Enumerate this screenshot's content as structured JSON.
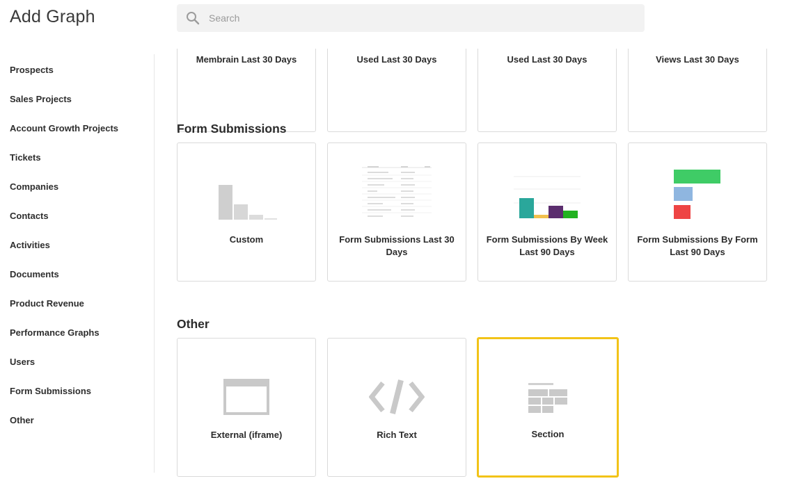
{
  "page": {
    "title": "Add Graph"
  },
  "search": {
    "placeholder": "Search"
  },
  "sidebar": {
    "items": [
      "Prospects",
      "Sales Projects",
      "Account Growth Projects",
      "Tickets",
      "Companies",
      "Contacts",
      "Activities",
      "Documents",
      "Product Revenue",
      "Performance Graphs",
      "Users",
      "Form Submissions",
      "Other"
    ]
  },
  "top_row": {
    "cards": [
      {
        "label": "Membrain Last 30 Days"
      },
      {
        "label": "Used Last 30 Days"
      },
      {
        "label": "Used Last 30 Days"
      },
      {
        "label": "Views Last 30 Days"
      }
    ]
  },
  "form_submissions": {
    "title": "Form Submissions",
    "cards": [
      {
        "label": "Custom",
        "icon": "bar-chart-icon"
      },
      {
        "label": "Form Submissions Last 30 Days",
        "icon": "table-preview-icon"
      },
      {
        "label": "Form Submissions By Week Last 90 Days",
        "icon": "column-chart-icon"
      },
      {
        "label": "Form Submissions By Form Last 90 Days",
        "icon": "horizontal-bar-chart-icon"
      }
    ]
  },
  "other": {
    "title": "Other",
    "cards": [
      {
        "label": "External (iframe)",
        "icon": "browser-window-icon"
      },
      {
        "label": "Rich Text",
        "icon": "code-icon"
      },
      {
        "label": "Section",
        "icon": "section-layout-icon",
        "selected": true
      }
    ]
  },
  "colors": {
    "selection_border": "#f2c318",
    "chart_teal": "#2aa79b",
    "chart_yellow": "#f2c14e",
    "chart_purple": "#5b2d6e",
    "chart_green": "#22b221",
    "hbar_green": "#3fcc66",
    "hbar_blue": "#8fb6e0",
    "hbar_red": "#ee4444",
    "icon_gray": "#c9c9c9"
  }
}
